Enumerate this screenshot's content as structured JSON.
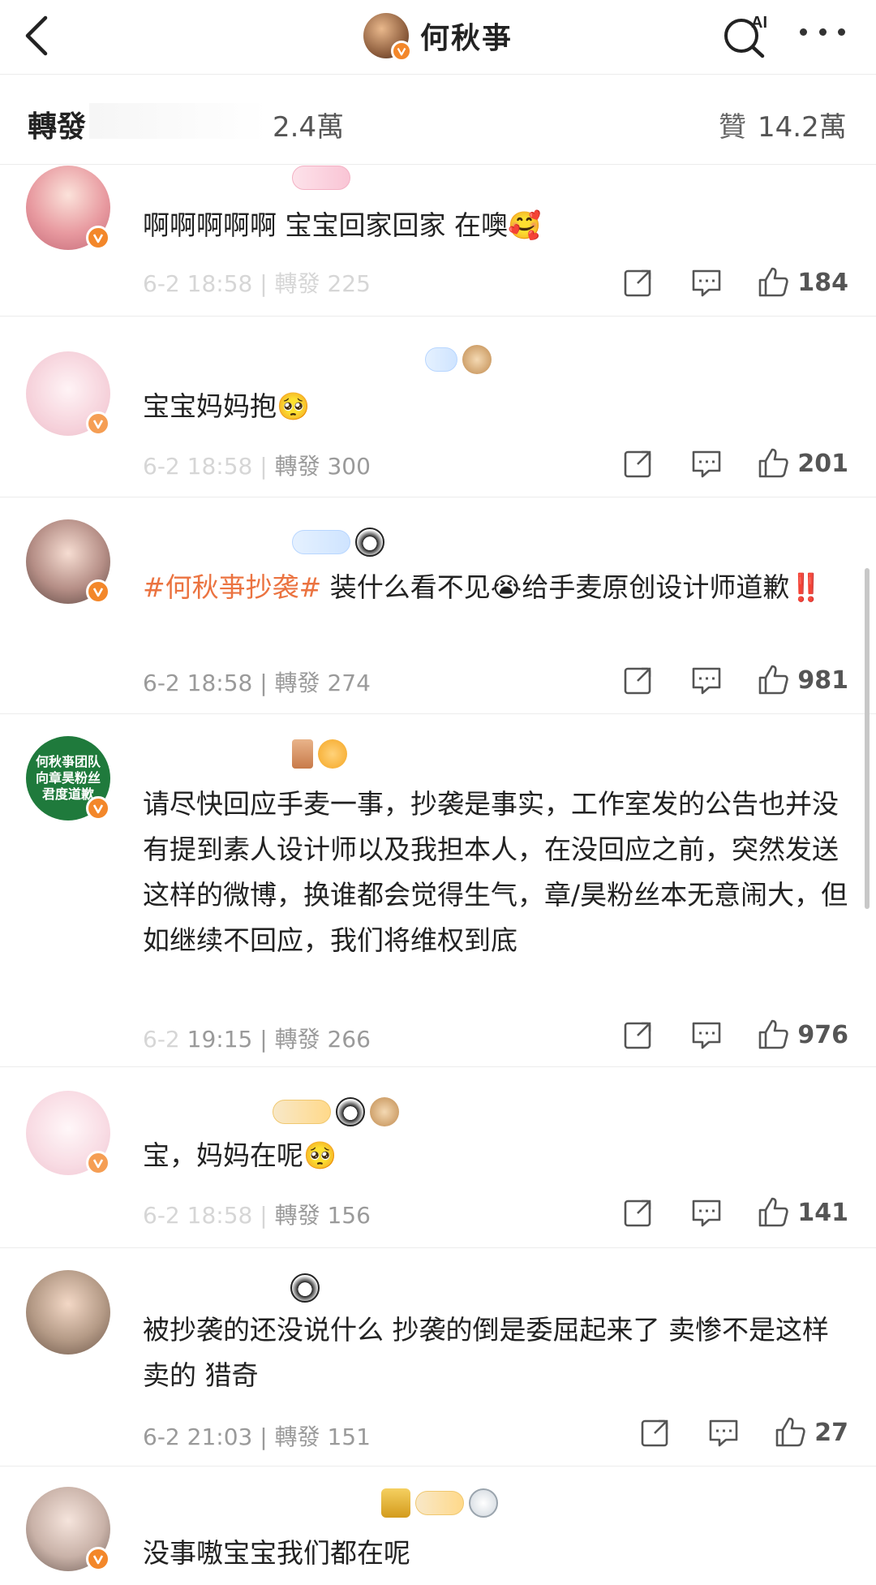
{
  "header": {
    "title": "何秋亊",
    "ai_label": "AI"
  },
  "subbar": {
    "repost_label": "轉發",
    "repost_count_visible": "2.4萬",
    "like_label": "贊",
    "like_count": "14.2萬"
  },
  "comments": [
    {
      "text": "啊啊啊啊啊 宝宝回家回家 在噢🥰",
      "meta_visible": "",
      "likes": "184"
    },
    {
      "text": "宝宝妈妈抱🥺",
      "meta_visible": "轉發 300",
      "likes": "201"
    },
    {
      "hashtag": "#何秋亊抄袭#",
      "text": " 装什么看不见😭给手麦原创设计师道歉‼️",
      "meta_visible": "6-2 18:58 | 轉發 274",
      "likes": "981"
    },
    {
      "avatar_text": "何秋亊团队 向章昊粉丝 君度道歉",
      "text": "请尽快回应手麦一事，抄袭是事实，工作室发的公告也并没有提到素人设计师以及我担本人，在没回应之前，突然发送这样的微博，换谁都会觉得生气，章/昊粉丝本无意闹大，但如继续不回应，我们将维权到底",
      "meta_visible": "19:15 | 轉發 266",
      "likes": "976"
    },
    {
      "text": "宝，妈妈在呢🥺",
      "meta_visible": "轉發 156",
      "likes": "141"
    },
    {
      "text": "被抄袭的还没说什么 抄袭的倒是委屈起来了 卖惨不是这样卖的 猎奇",
      "meta_visible": "6-2 21:03 | 轉發 151",
      "likes": "27"
    },
    {
      "text": "没事嗷宝宝我们都在呢"
    }
  ],
  "icons": {
    "back": "chevron-left-icon",
    "search": "ai-search-icon",
    "more": "more-icon",
    "verified": "verified-badge-icon",
    "share": "share-icon",
    "comment": "comment-icon",
    "like": "thumbs-up-icon"
  },
  "colors": {
    "hashtag": "#eb7340",
    "verified": "#f3872a",
    "text": "#222222",
    "meta": "#9a9a9a"
  }
}
